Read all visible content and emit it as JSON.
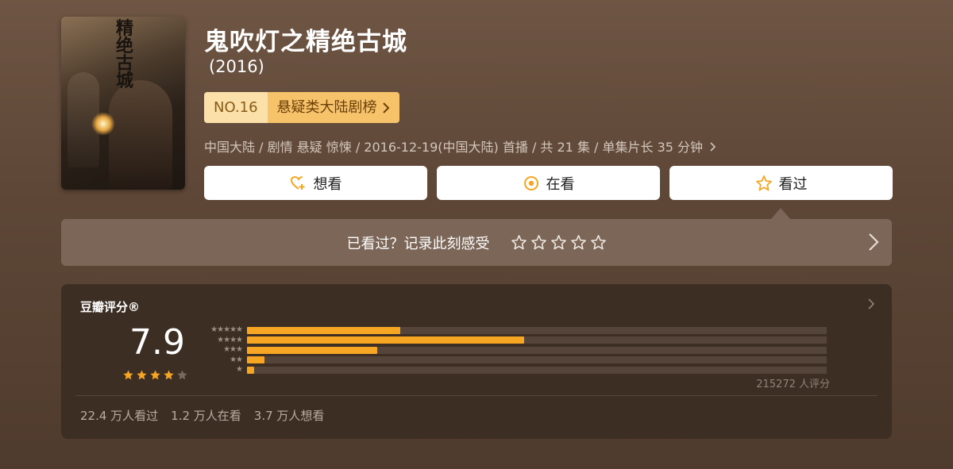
{
  "movie": {
    "title": "鬼吹灯之精绝古城",
    "year": "(2016)",
    "poster_text": "精绝古城"
  },
  "rank": {
    "no": "NO.16",
    "category": "悬疑类大陆剧榜"
  },
  "meta": "中国大陆 / 剧情 悬疑 惊悚 / 2016-12-19(中国大陆) 首播 / 共 21 集 / 单集片长 35 分钟",
  "actions": [
    {
      "label": "想看",
      "icon": "heart-plus-icon"
    },
    {
      "label": "在看",
      "icon": "target-icon"
    },
    {
      "label": "看过",
      "icon": "star-icon"
    }
  ],
  "record": {
    "prompt": "已看过？记录此刻感受",
    "stars": 5
  },
  "rating": {
    "label": "豆瓣评分®",
    "score": "7.9",
    "stars_filled": 4,
    "stars_total": 5,
    "distribution": [
      {
        "stars": "★★★★★",
        "pct": 26.5
      },
      {
        "stars": "★★★★",
        "pct": 47.8
      },
      {
        "stars": "★★★",
        "pct": 22.4
      },
      {
        "stars": "★★",
        "pct": 3.0
      },
      {
        "stars": "★",
        "pct": 1.3
      }
    ],
    "count": "215272 人评分",
    "stats": [
      "22.4 万人看过",
      "1.2 万人在看",
      "3.7 万人想看"
    ]
  },
  "colors": {
    "accent": "#f6a623",
    "rank_bg": "#fbe1a9",
    "rank_cat_bg": "#f7c36a",
    "panel": "#3d2e24"
  }
}
